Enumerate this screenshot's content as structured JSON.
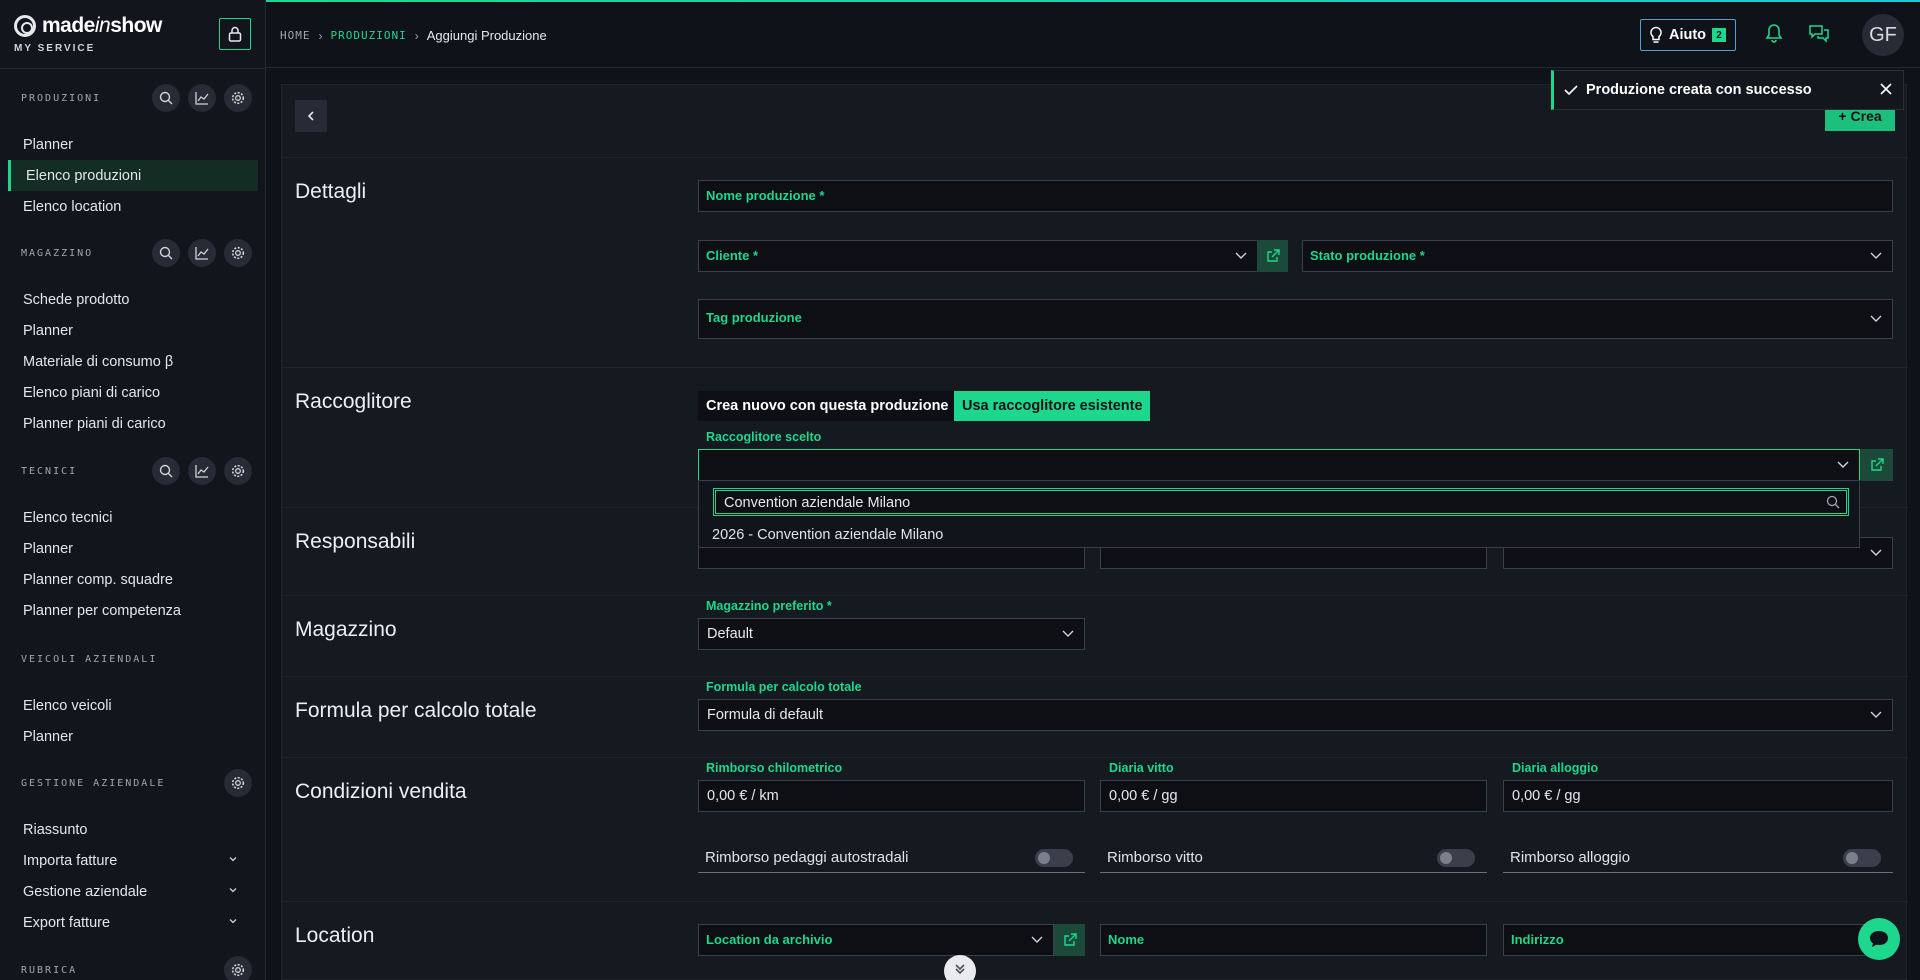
{
  "brand": {
    "name_a": "made",
    "name_b": "in",
    "name_c": "show",
    "subtitle": "MY SERVICE"
  },
  "sidebar": {
    "sections": [
      {
        "title": "PRODUZIONI",
        "items": [
          "Planner",
          "Elenco produzioni",
          "Elenco location"
        ],
        "active": "Elenco produzioni"
      },
      {
        "title": "MAGAZZINO",
        "items": [
          "Schede prodotto",
          "Planner",
          "Materiale di consumo β",
          "Elenco piani di carico",
          "Planner piani di carico"
        ]
      },
      {
        "title": "TECNICI",
        "items": [
          "Elenco tecnici",
          "Planner",
          "Planner comp. squadre",
          "Planner per competenza"
        ]
      },
      {
        "title": "VEICOLI AZIENDALI",
        "items": [
          "Elenco veicoli",
          "Planner"
        ]
      },
      {
        "title": "GESTIONE AZIENDALE",
        "items": [
          "Riassunto",
          "Importa fatture",
          "Gestione aziendale",
          "Export fatture"
        ]
      },
      {
        "title": "RUBRICA",
        "items": []
      }
    ]
  },
  "header": {
    "breadcrumb": [
      "HOME",
      "PRODUZIONI",
      "Aggiungi Produzione"
    ],
    "help_label": "Aiuto",
    "help_count": "2",
    "avatar_initials": "GF"
  },
  "toolbar": {
    "create_label": "Crea"
  },
  "toast": {
    "message": "Produzione creata con successo"
  },
  "form": {
    "dettagli": {
      "title": "Dettagli",
      "nome_placeholder": "Nome produzione *",
      "cliente_placeholder": "Cliente *",
      "stato_placeholder": "Stato produzione *",
      "tag_placeholder": "Tag produzione"
    },
    "raccoglitore": {
      "title": "Raccoglitore",
      "tab_new": "Crea nuovo con questa produzione",
      "tab_existing": "Usa raccoglitore esistente",
      "chosen_label": "Raccoglitore scelto",
      "search_value": "Convention aziendale Milano",
      "option": "2026 - Convention aziendale Milano"
    },
    "responsabili": {
      "title": "Responsabili"
    },
    "magazzino": {
      "title": "Magazzino",
      "label": "Magazzino preferito *",
      "value": "Default"
    },
    "formula": {
      "title": "Formula per calcolo totale",
      "label": "Formula per calcolo totale",
      "value": "Formula di default"
    },
    "condizioni": {
      "title": "Condizioni vendita",
      "km_label": "Rimborso chilometrico",
      "km_value": "0,00 € / km",
      "vitto_label": "Diaria vitto",
      "vitto_value": "0,00 € / gg",
      "alloggio_label": "Diaria alloggio",
      "alloggio_value": "0,00 € / gg",
      "toggle_pedaggi": "Rimborso pedaggi autostradali",
      "toggle_vitto": "Rimborso vitto",
      "toggle_alloggio": "Rimborso alloggio"
    },
    "location": {
      "title": "Location",
      "archivio_placeholder": "Location da archivio",
      "nome_placeholder": "Nome",
      "indirizzo_placeholder": "Indirizzo"
    }
  }
}
